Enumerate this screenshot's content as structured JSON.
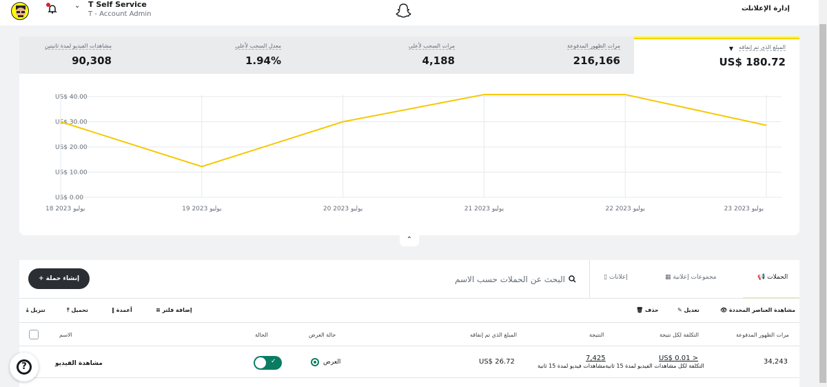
{
  "topbar": {
    "account_name": "T Self Service",
    "account_role": "T - Account Admin",
    "ads_manager": "إدارة الإعلانات",
    "colors": {
      "brand": "#fffc00",
      "notification": "#e01e2a"
    }
  },
  "metrics": [
    {
      "label": "المبلغ الذي تم إنفاقه",
      "value": "US$ 180.72",
      "active": true
    },
    {
      "label": "مرات الظهور المدفوعة",
      "value": "216,166"
    },
    {
      "label": "مرات السحب لأعلى",
      "value": "4,188"
    },
    {
      "label": "معدل السحب لأعلى",
      "value": "1.94%"
    },
    {
      "label": "مشاهدات الفيديو لمدة ثانيتين",
      "value": "90,308"
    }
  ],
  "chart_data": {
    "type": "line",
    "categories": [
      "18 يوليو 2023",
      "19 يوليو 2023",
      "20 يوليو 2023",
      "21 يوليو 2023",
      "22 يوليو 2023",
      "23 يوليو 2023"
    ],
    "values": [
      30.0,
      12.2,
      30.0,
      40.8,
      40.8,
      28.6
    ],
    "yticks": [
      "US$ 0.00",
      "US$ 10.00",
      "US$ 20.00",
      "US$ 30.00",
      "US$ 40.00"
    ],
    "ylim": [
      0,
      40
    ],
    "grid": true,
    "color": "#f5c800"
  },
  "table": {
    "create_button": "إنشاء حملة",
    "search_placeholder": "البحث عن الحملات حسب الاسم",
    "tabs": [
      "الحملات",
      "مجموعات إعلانية",
      "إعلانات"
    ],
    "toolbar_left": [
      "تنزيل",
      "تحميل",
      "أعمدة",
      "إضافة فلتر"
    ],
    "toolbar_right": [
      "مشاهدة العناصر المحددة",
      "تعديل",
      "حذف"
    ],
    "headers": [
      "الاسم",
      "الحالة",
      "حالة العرض",
      "المبلغ الذي تم إنفاقه",
      "النتيجة",
      "التكلفة لكل نتيجة",
      "مرات الظهور المدفوعة"
    ],
    "rows": [
      {
        "name": "مشاهدة الفيديو",
        "delivery": "العرض",
        "spent": "US$ 26.72",
        "result": "7,425",
        "cost_per_result": "< US$ 0.01",
        "result_note": "التكلفة لكل مشاهدات الفيديو لمدة 15 ثانيةمشاهدات فيديو لمدة 15 ثانية",
        "impressions": "34,243"
      }
    ]
  }
}
